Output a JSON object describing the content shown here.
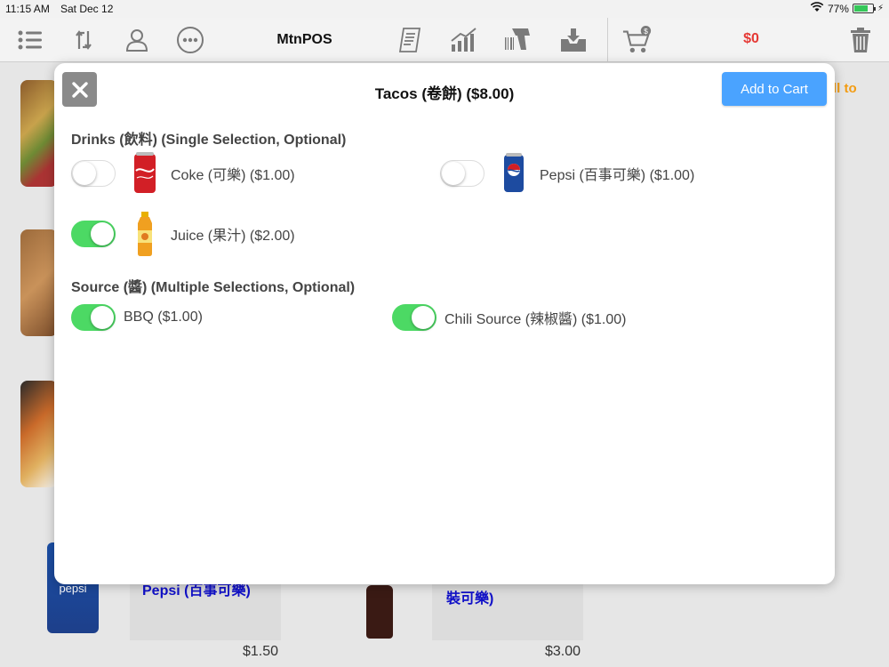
{
  "status_bar": {
    "time": "11:15 AM",
    "date": "Sat Dec 12",
    "battery": "77%",
    "battery_level": 0.77
  },
  "toolbar": {
    "title": "MtnPOS",
    "cart_total": "$0",
    "icons": [
      "menu-list-icon",
      "sync-icon",
      "user-icon",
      "more-icon",
      "receipt-icon",
      "chart-icon",
      "barcode-scanner-icon",
      "inbox-download-icon",
      "cart-icon",
      "trash-icon"
    ]
  },
  "background": {
    "right_panel_hint": "ll to",
    "cards": [
      {
        "name": "Pepsi (百事可樂)",
        "price": "$1.50",
        "image_label": "pepsi"
      },
      {
        "name": "裝可樂)",
        "price": "$3.00"
      }
    ]
  },
  "modal": {
    "title": "Tacos (卷餅) ($8.00)",
    "add_button": "Add to Cart",
    "sections": [
      {
        "title": "Drinks (飲料) (Single Selection, Optional)",
        "options": [
          {
            "label": "Coke (可樂) ($1.00)",
            "on": false,
            "icon": "coke-can-icon"
          },
          {
            "label": "Pepsi (百事可樂) ($1.00)",
            "on": false,
            "icon": "pepsi-can-icon"
          },
          {
            "label": "Juice (果汁) ($2.00)",
            "on": true,
            "icon": "juice-bottle-icon"
          }
        ]
      },
      {
        "title": "Source (醬) (Multiple Selections, Optional)",
        "options": [
          {
            "label": "BBQ ($1.00)",
            "on": true
          },
          {
            "label": "Chili Source (辣椒醬) ($1.00)",
            "on": true
          }
        ]
      }
    ]
  },
  "colors": {
    "accent": "#4aa3ff",
    "toggle_on": "#4cd964",
    "price_red": "#e53935",
    "link_blue": "#1010c8",
    "hint_orange": "#f39c12"
  }
}
